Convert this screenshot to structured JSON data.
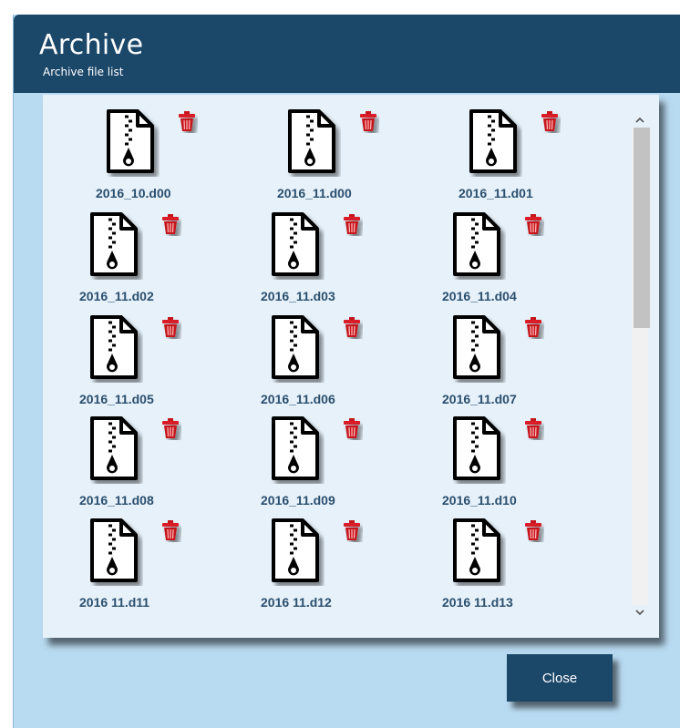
{
  "dialog": {
    "title": "Archive",
    "subtitle": "Archive file list",
    "close_label": "Close"
  },
  "files": [
    {
      "name": "2016_10.d00"
    },
    {
      "name": "2016_11.d00"
    },
    {
      "name": "2016_11.d01"
    },
    {
      "name": "2016_11.d02"
    },
    {
      "name": "2016_11.d03"
    },
    {
      "name": "2016_11.d04"
    },
    {
      "name": "2016_11.d05"
    },
    {
      "name": "2016_11.d06"
    },
    {
      "name": "2016_11.d07"
    },
    {
      "name": "2016_11.d08"
    },
    {
      "name": "2016_11.d09"
    },
    {
      "name": "2016_11.d10"
    },
    {
      "name": "2016 11.d11"
    },
    {
      "name": "2016 11.d12"
    },
    {
      "name": "2016 11.d13"
    }
  ],
  "icons": {
    "file": "zip-file-icon",
    "delete": "trash-icon",
    "scroll_up": "chevron-up-icon",
    "scroll_down": "chevron-down-icon"
  },
  "colors": {
    "titlebar": "#1b4769",
    "dialog_background": "#b9dbf2",
    "panel_background": "#e6f1fa",
    "filename_text": "#2b4f6e",
    "trash_red": "#c4161c"
  }
}
